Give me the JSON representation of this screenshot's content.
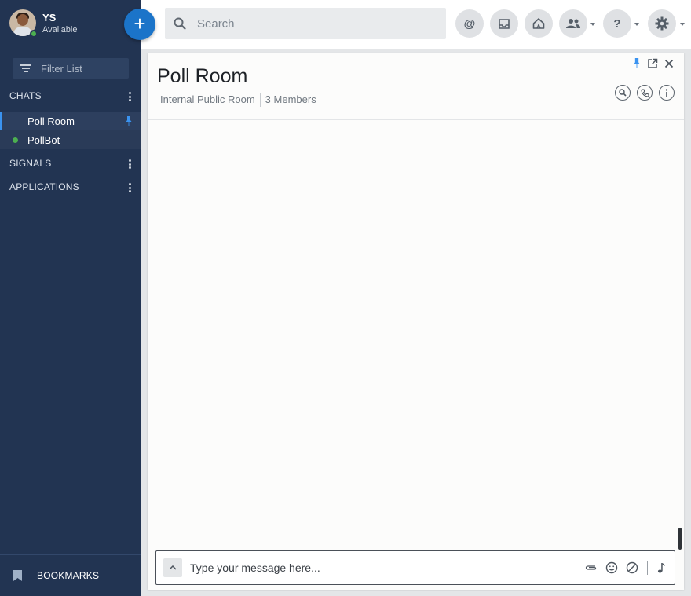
{
  "user": {
    "initials": "YS",
    "status": "Available"
  },
  "sidebar": {
    "filter_placeholder": "Filter List",
    "sections": {
      "chats": "CHATS",
      "signals": "SIGNALS",
      "applications": "APPLICATIONS"
    },
    "chats": [
      {
        "label": "Poll Room",
        "pinned": true,
        "active": true
      },
      {
        "label": "PollBot",
        "online": true
      }
    ],
    "bookmarks_label": "BOOKMARKS"
  },
  "topbar": {
    "new_button": "+",
    "search_placeholder": "Search",
    "mention_symbol": "@",
    "help_symbol": "?"
  },
  "room": {
    "title": "Poll Room",
    "type": "Internal Public Room",
    "members": "3 Members"
  },
  "composer": {
    "placeholder": "Type your message here..."
  },
  "colors": {
    "sidebar_bg": "#223452",
    "accent": "#1b74c9",
    "online": "#4caf50",
    "pin": "#3a93f0"
  }
}
